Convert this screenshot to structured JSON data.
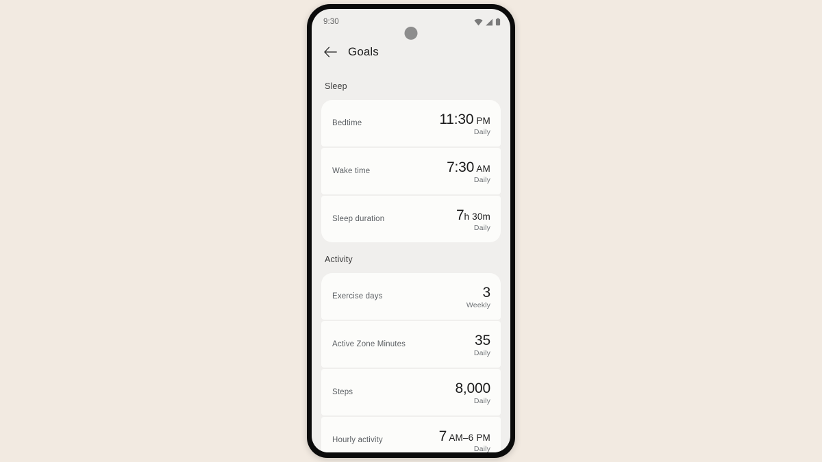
{
  "status_bar": {
    "time": "9:30",
    "icons": [
      "wifi-icon",
      "cell-signal-icon",
      "battery-icon"
    ]
  },
  "app_bar": {
    "back_icon": "back-arrow-icon",
    "title": "Goals"
  },
  "sections": [
    {
      "header": "Sleep",
      "rows": [
        {
          "label": "Bedtime",
          "value": "11:30",
          "unit": " PM",
          "cadence": "Daily"
        },
        {
          "label": "Wake time",
          "value": "7:30",
          "unit": " AM",
          "cadence": "Daily"
        },
        {
          "label": "Sleep duration",
          "value": "7",
          "unit": "h 30",
          "unit2": "m",
          "cadence": "Daily"
        }
      ]
    },
    {
      "header": "Activity",
      "rows": [
        {
          "label": "Exercise days",
          "value": "3",
          "unit": "",
          "cadence": "Weekly"
        },
        {
          "label": "Active Zone Minutes",
          "value": "35",
          "unit": "",
          "cadence": "Daily"
        },
        {
          "label": "Steps",
          "value": "8,000",
          "unit": "",
          "cadence": "Daily"
        },
        {
          "label": "Hourly activity",
          "value": "7",
          "unit": " AM–6 ",
          "unit3": "PM",
          "cadence": "Daily"
        }
      ]
    }
  ],
  "colors": {
    "page_background": "#F2EAE1",
    "screen_background": "#F0EFED",
    "card_background": "#FCFCFA",
    "phone_bezel": "#0B0B0B",
    "primary_text": "#1B1B1B",
    "secondary_text": "#5B5F63"
  }
}
